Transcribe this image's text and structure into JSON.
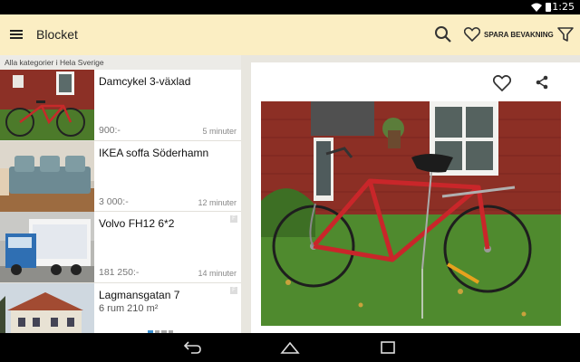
{
  "statusbar": {
    "time": "11:25"
  },
  "appbar": {
    "title": "Blocket",
    "save_label": "SPARA BEVAKNING",
    "icons": [
      "menu-icon",
      "search-icon",
      "heart-icon",
      "filter-icon"
    ]
  },
  "breadcrumb": "Alla kategorier i Hela Sverige",
  "listings": [
    {
      "title": "Damcykel 3-växlad",
      "price": "900:-",
      "time": "5 minuter",
      "badge": "",
      "subtitle": ""
    },
    {
      "title": "IKEA soffa Söderhamn",
      "price": "3 000:-",
      "time": "12 minuter",
      "badge": "",
      "subtitle": ""
    },
    {
      "title": "Volvo FH12 6*2",
      "price": "181 250:-",
      "time": "14 minuter",
      "badge": "F",
      "subtitle": ""
    },
    {
      "title": "Lagmansgatan 7",
      "price": "",
      "time": "",
      "badge": "F",
      "subtitle": "6 rum    210 m²"
    }
  ],
  "detail": {
    "icons": [
      "heart-outline-icon",
      "share-icon"
    ],
    "gallery_count": 4,
    "gallery_active": 1
  },
  "colors": {
    "appbar": "#fbeec3",
    "background": "#e8e6df",
    "accent": "#3f92d2"
  }
}
